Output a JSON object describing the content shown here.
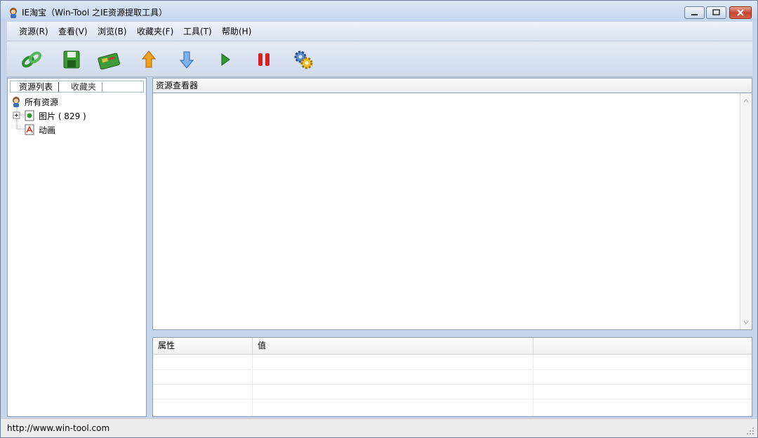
{
  "window": {
    "title": "IE淘宝（Win-Tool 之IE资源提取工具）",
    "buttons": [
      "minimize",
      "maximize",
      "close"
    ]
  },
  "menu": [
    {
      "label": "资源(R)"
    },
    {
      "label": "查看(V)"
    },
    {
      "label": "浏览(B)"
    },
    {
      "label": "收藏夹(F)"
    },
    {
      "label": "工具(T)"
    },
    {
      "label": "帮助(H)"
    }
  ],
  "toolbar": {
    "icons": [
      "link-icon",
      "save-icon",
      "card-icon",
      "up-arrow-icon",
      "down-arrow-icon",
      "play-icon",
      "pause-icon",
      "settings-icon"
    ]
  },
  "left": {
    "tabs": [
      "资源列表",
      "收藏夹"
    ],
    "tree": {
      "root": "所有资源",
      "children": [
        {
          "label": "图片 ( 829 )"
        },
        {
          "label": "动画"
        }
      ]
    }
  },
  "viewer": {
    "title": "资源查看器"
  },
  "props": {
    "headers": [
      "属性",
      "值",
      ""
    ],
    "rows": 4
  },
  "status": {
    "text": "http://www.win-tool.com"
  },
  "colors": {
    "chrome": "#c7d6ea",
    "close_red": "#c6422b",
    "play_green": "#2f9a2f",
    "pause_red": "#d62222",
    "arrow_orange": "#f0a020",
    "arrow_blue": "#3f7fd6"
  }
}
